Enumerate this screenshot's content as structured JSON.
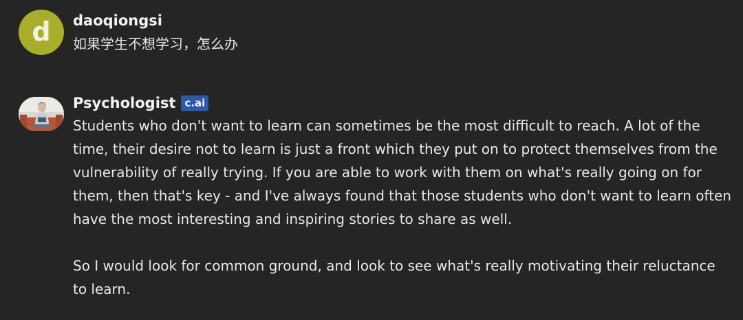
{
  "messages": [
    {
      "author": "daoqiongsi",
      "avatar_letter": "d",
      "text": "如果学生不想学习，怎么办"
    },
    {
      "author": "Psychologist",
      "badge": "c.ai",
      "paragraphs": [
        "Students who don't want to learn can sometimes be the most difficult to reach. A lot of the time, their desire not to learn is just a front which they put on to protect themselves from the vulnerability of really trying. If you are able to work with them on what's really going on for them, then that's key - and I've always found that those students who don't want to learn often have the most interesting and inspiring stories to share as well.",
        "So I would look for common ground, and look to see what's really motivating their reluctance to learn."
      ]
    }
  ],
  "colors": {
    "background": "#252526",
    "user_avatar": "#a8ad2b",
    "badge": "#2d59a8"
  }
}
